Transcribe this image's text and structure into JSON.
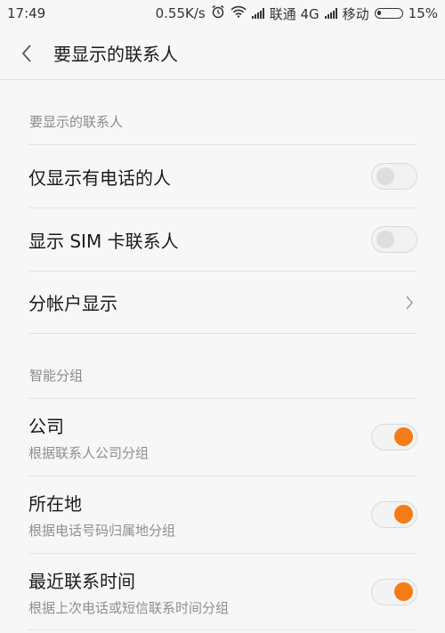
{
  "status_bar": {
    "time": "17:49",
    "speed": "0.55K/s",
    "carrier1": "联通 4G",
    "carrier2": "移动",
    "battery": "15%"
  },
  "header": {
    "title": "要显示的联系人"
  },
  "sections": [
    {
      "header": "要显示的联系人",
      "items": [
        {
          "label": "仅显示有电话的人",
          "control": "toggle",
          "checked": false
        },
        {
          "label": "显示 SIM 卡联系人",
          "control": "toggle",
          "checked": false
        },
        {
          "label": "分帐户显示",
          "control": "chevron"
        }
      ]
    },
    {
      "header": "智能分组",
      "items": [
        {
          "label": "公司",
          "sub": "根据联系人公司分组",
          "control": "toggle",
          "checked": true
        },
        {
          "label": "所在地",
          "sub": "根据电话号码归属地分组",
          "control": "toggle",
          "checked": true
        },
        {
          "label": "最近联系时间",
          "sub": "根据上次电话或短信联系时间分组",
          "control": "toggle",
          "checked": true
        }
      ]
    }
  ],
  "colors": {
    "accent": "#f57b16",
    "background": "#f7f7f7",
    "divider": "#e4e4e4",
    "secondary_text": "#8f8f8f"
  },
  "icons": [
    "alarm-icon",
    "wifi-icon",
    "signal-icon",
    "battery-icon",
    "back-icon",
    "chevron-right-icon"
  ]
}
